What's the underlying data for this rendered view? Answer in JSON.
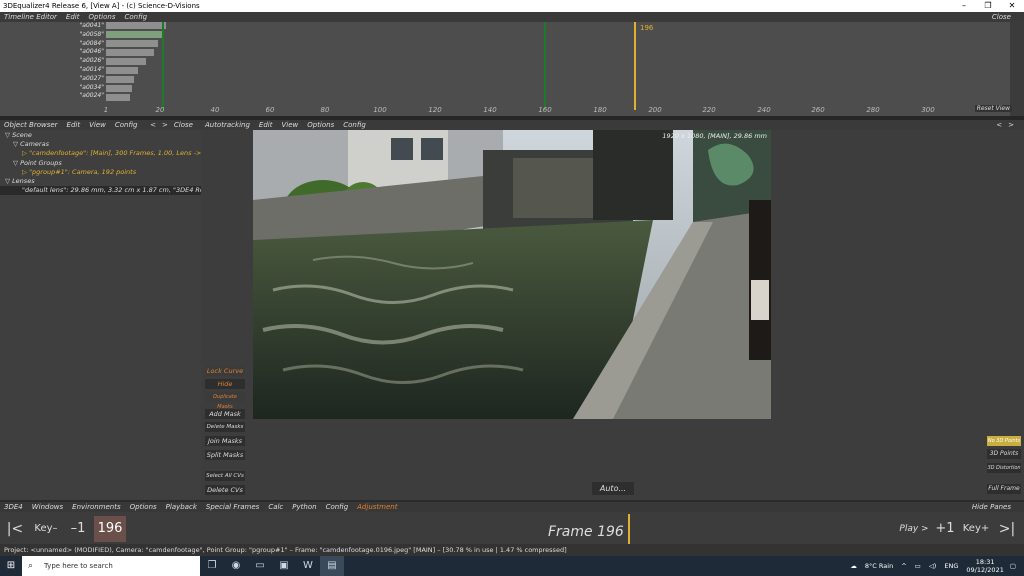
{
  "window": {
    "title": "3DEqualizer4 Release 6, [View A] - (c) Science-D-Visions",
    "controls": [
      "–",
      "❐",
      "✕"
    ]
  },
  "timeline": {
    "menu": [
      "Timeline Editor",
      "Edit",
      "Options",
      "Config"
    ],
    "close_label": "Close",
    "point_names": [
      "\"a0041\"",
      "\"a0058\"",
      "\"a0084\"",
      "\"a0046\"",
      "\"a0026\"",
      "\"a0014\"",
      "\"a0027\"",
      "\"a0034\"",
      "\"a0024\""
    ],
    "ruler": [
      "1",
      "20",
      "40",
      "60",
      "80",
      "100",
      "120",
      "140",
      "160",
      "180",
      "200",
      "220",
      "240",
      "260",
      "280",
      "300"
    ],
    "current_frame_label": "196",
    "reset_view_label": "Reset View",
    "colors": {
      "green_line": "#1e7a2a",
      "frame_line": "#e0b030"
    }
  },
  "object_browser": {
    "menu": [
      "Object Browser",
      "Edit",
      "View",
      "Config"
    ],
    "nav": [
      "<",
      ">",
      "Close"
    ],
    "tree": [
      {
        "text": "▽ Scene",
        "indent": 1,
        "style": "normal"
      },
      {
        "text": "▽ Cameras",
        "indent": 2,
        "style": "normal"
      },
      {
        "text": "▷ \"camdenfootage\":  [Main], 300 Frames, 1.00, Lens ->",
        "indent": 3,
        "style": "sel"
      },
      {
        "text": "▽ Point Groups",
        "indent": 2,
        "style": "normal"
      },
      {
        "text": "▷ \"pgroup#1\":  Camera, 192 points",
        "indent": 3,
        "style": "sel"
      },
      {
        "text": "▽ Lenses",
        "indent": 1,
        "style": "normal"
      },
      {
        "text": "\"default lens\":  29.86 mm, 3.32 cm x 1.87 cm, \"3DE4 Ro",
        "indent": 3,
        "style": "hl"
      }
    ]
  },
  "viewer": {
    "menu": [
      "Autotracking",
      "Edit",
      "View",
      "Options",
      "Config"
    ],
    "nav": [
      "<",
      ">"
    ],
    "info": "1920 x 1080, [MAIN], 29.86 mm",
    "left_buttons": [
      "Lock Curve",
      "Hide",
      "Duplicate Masks",
      "Add Mask",
      "Delete Masks",
      "Join Masks",
      "Split Masks",
      "Select All CVs",
      "Delete CVs"
    ],
    "right_buttons": [
      "No 3D Points",
      "3D Points",
      "3D Distortion",
      "Full Frame"
    ],
    "auto_button": "Auto..."
  },
  "main_menu": {
    "items": [
      "3DE4",
      "Windows",
      "Environments",
      "Options",
      "Playback",
      "Special Frames",
      "Calc",
      "Python",
      "Config",
      "Adjustment"
    ],
    "hide_panes": "Hide Panes"
  },
  "transport": {
    "first": "|<",
    "key_prev": "Key–",
    "minus": "–1",
    "frame": "196",
    "frame_label": "Frame 196",
    "play": "Play >",
    "plus": "+1",
    "key_next": "Key+",
    "last": ">|"
  },
  "status": "Project: <unnamed>  (MODIFIED), Camera: \"camdenfootage\", Point Group: \"pgroup#1\"  –  Frame: \"camdenfootage.0196.jpeg\"  [MAIN]  –  [30.78 % in use | 1.47 % compressed]",
  "taskbar": {
    "search_placeholder": "Type here to search",
    "weather": "8°C  Rain",
    "time": "18:31",
    "date": "09/12/2021"
  }
}
